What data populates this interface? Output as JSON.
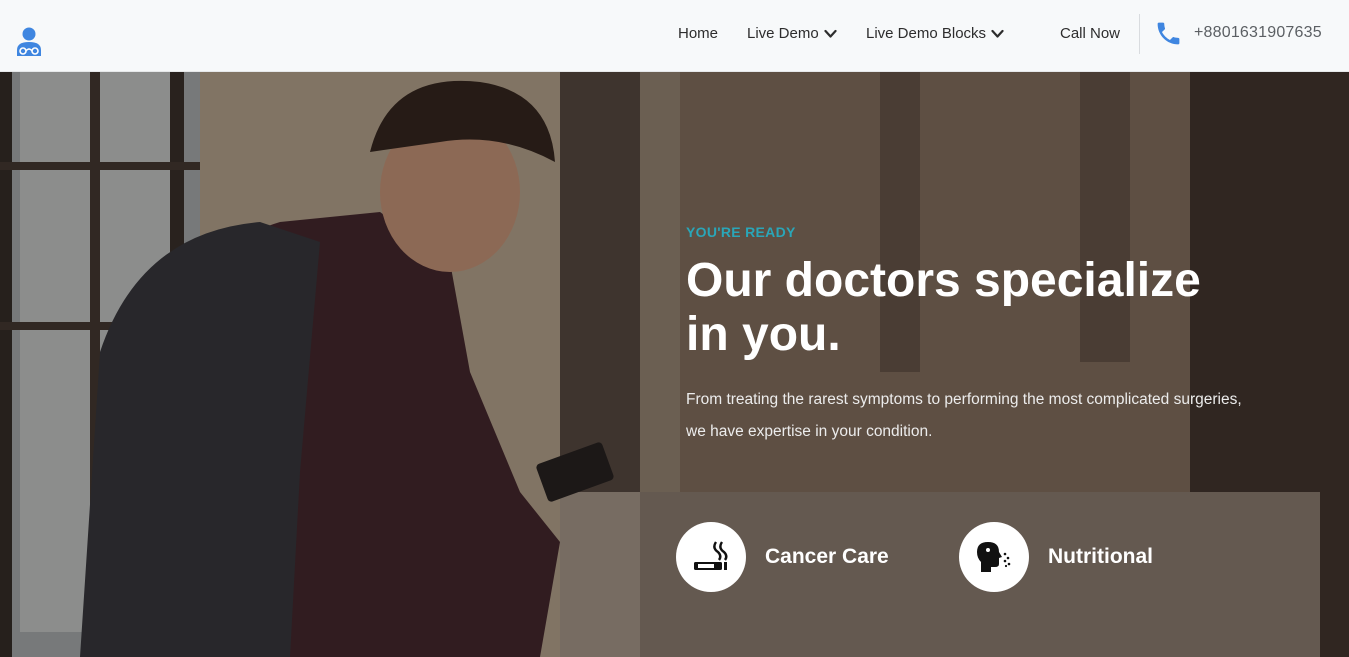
{
  "header": {
    "nav": [
      {
        "label": "Home"
      },
      {
        "label": "Live Demo",
        "has_dropdown": true
      },
      {
        "label": "Live Demo Blocks",
        "has_dropdown": true
      },
      {
        "label": "Call Now"
      }
    ],
    "phone": "+8801631907635",
    "icons": {
      "logo": "doctor-logo-icon",
      "phone": "phone-icon",
      "dropdown": "chevron-down-icon"
    }
  },
  "hero": {
    "eyebrow": "YOU'RE READY",
    "title_line1": "Our doctors specialize",
    "title_line2": "in you.",
    "description": "From treating the rarest symptoms to performing the most complicated surgeries, we have expertise in your condition.",
    "features": [
      {
        "label": "Cancer Care",
        "icon": "no-smoking-cigarette-icon"
      },
      {
        "label": "Nutritional",
        "icon": "head-breathing-icon"
      }
    ]
  },
  "colors": {
    "accent": "#2aa6b8",
    "brand_blue": "#3f86e0",
    "header_bg": "#f7f9fa"
  }
}
